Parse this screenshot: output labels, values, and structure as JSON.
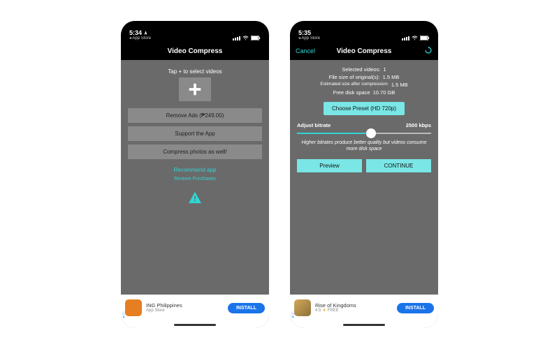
{
  "left": {
    "status": {
      "time": "5:34",
      "back": "◂ App Store"
    },
    "nav": {
      "title": "Video Compress"
    },
    "tap_text": "Tap + to select videos",
    "buttons": {
      "remove_ads": "Remove Ads (₱249.00)",
      "support": "Support the App",
      "compress_photos": "Compress photos as well!"
    },
    "links": {
      "recommend": "Recommend app",
      "restore": "Restore Purchases"
    },
    "ad": {
      "title": "ING Philippines",
      "sub": "App Store",
      "install": "INSTALL"
    }
  },
  "right": {
    "status": {
      "time": "5:35",
      "back": "◂ App Store"
    },
    "nav": {
      "title": "Video Compress",
      "cancel": "Cancel"
    },
    "info": {
      "selected_lbl": "Selected videos:",
      "selected_val": "1",
      "filesize_lbl": "File size of original(s):",
      "filesize_val": "1.5 MB",
      "est_lbl": "Estimated size after compression:",
      "est_val": "1.5 MB",
      "free_lbl": "Free disk space",
      "free_val": "10.70 GB"
    },
    "preset_btn": "Choose Preset (HD 720p)",
    "bitrate": {
      "label": "Adjust bitrate",
      "value": "2500 kbps"
    },
    "hint": "Higher bitrates produce better quality but videos consume more disk space",
    "actions": {
      "preview": "Preview",
      "continue": "CONTINUE"
    },
    "ad": {
      "title": "Rise of Kingdoms",
      "rating": "4.5",
      "free": "FREE",
      "install": "INSTALL"
    }
  }
}
